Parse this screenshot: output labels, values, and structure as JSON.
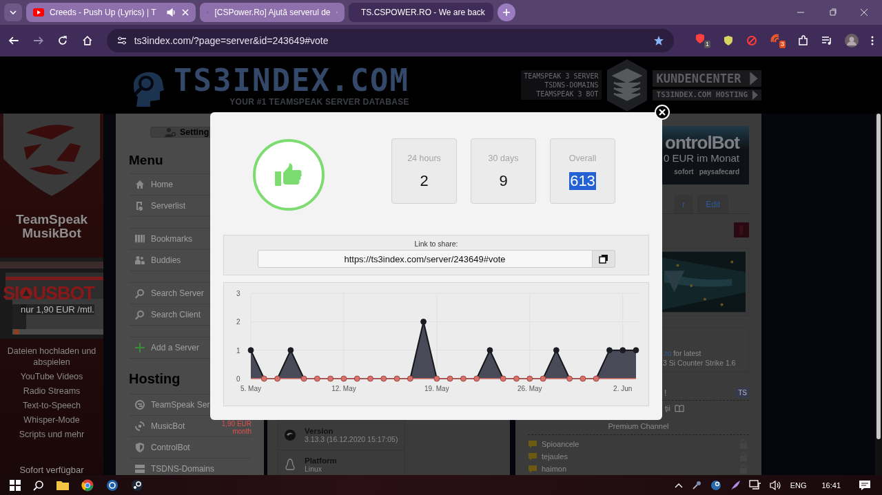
{
  "browser": {
    "tabs": [
      {
        "title": "Creeds - Push Up (Lyrics) | T",
        "selected": false,
        "playing_audio": true
      },
      {
        "title": "[CSPower.Ro] Ajută serverul de",
        "selected": false,
        "playing_audio": false
      },
      {
        "title": "TS.CSPOWER.RO - We are back",
        "selected": true,
        "playing_audio": false
      }
    ],
    "address": "ts3index.com/?page=server&id=243649#vote",
    "extension_badges": [
      "1",
      "3"
    ]
  },
  "site_header": {
    "logo": "TS3INDEX.COM",
    "tagline": "YOUR #1 TEAMSPEAK SERVER DATABASE",
    "services": [
      "TEAMSPEAK 3 SERVER",
      "TSDNS-DOMAINS",
      "TEAMSPEAK 3 BOT"
    ],
    "links": [
      "KUNDENCENTER",
      "TS3INDEX.COM HOSTING"
    ]
  },
  "left_ad": {
    "title": "TeamSpeak MusikBot",
    "brand_start": "SI",
    "brand_end": "USBOT",
    "price": "nur 1,90 EUR /mtl.",
    "features": [
      "Dateien hochladen und abspielen",
      "YouTube Videos",
      "Radio Streams",
      "Text-to-Speech",
      "Whisper-Mode",
      "Scripts und mehr"
    ],
    "footer": "Sofort verfügbar"
  },
  "sidebar": {
    "settings_button": "Setting",
    "menu_title": "Menu",
    "menu_groups": [
      [
        "Home",
        "Serverlist"
      ],
      [
        "Bookmarks",
        "Buddies"
      ],
      [
        "Search Server",
        "Search Client"
      ],
      [
        "Add a Server"
      ]
    ],
    "hosting_title": "Hosting",
    "hosting_items": [
      {
        "label": "TeamSpeak Ser"
      },
      {
        "label": "MusicBot",
        "price": "1,90 EUR",
        "period": "month"
      },
      {
        "label": "ControlBot"
      },
      {
        "label": "TSDNS-Domains"
      }
    ]
  },
  "server_info": [
    {
      "label": "Version",
      "value": "3.13.3 (16.12.2020 15:17:05)"
    },
    {
      "label": "Platform",
      "value": "Linux"
    }
  ],
  "right_panel": {
    "banner": {
      "headline": "ontrolBot",
      "price": "0 EUR  im Monat",
      "payments": [
        "sofort",
        "paysafecard"
      ]
    },
    "tabs": [
      {
        "label": "r",
        "selected": false
      },
      {
        "label": "Edit",
        "selected": false
      }
    ],
    "description": {
      "link": ".ro",
      "text": " for latest",
      "line2": "3 Si Counter Strike 1.6"
    },
    "viewer": {
      "title": "!",
      "badge": "TS",
      "top_channel": "ții",
      "premium": "Premium Channel",
      "channels": [
        {
          "name": "Spioancele",
          "locked": true
        },
        {
          "name": "tejaules",
          "locked": true
        },
        {
          "name": "haimon",
          "locked": true
        }
      ]
    }
  },
  "vote_modal": {
    "stats": [
      {
        "label": "24 hours",
        "value": "2",
        "highlighted": false
      },
      {
        "label": "30 days",
        "value": "9",
        "highlighted": false
      },
      {
        "label": "Overall",
        "value": "613",
        "highlighted": true
      }
    ],
    "share_label": "Link to share:",
    "share_url": "https://ts3index.com/server/243649#vote",
    "chart_data": {
      "type": "area",
      "categories": [
        "5. May",
        null,
        null,
        null,
        null,
        null,
        null,
        "12. May",
        null,
        null,
        null,
        null,
        null,
        null,
        "19. May",
        null,
        null,
        null,
        null,
        null,
        null,
        "26. May",
        null,
        null,
        null,
        null,
        null,
        null,
        "2. Jun",
        null
      ],
      "series": [
        {
          "color": "#484b57",
          "values": [
            1,
            0,
            0,
            1,
            0,
            0,
            0,
            0,
            0,
            0,
            0,
            0,
            0,
            2,
            0,
            0,
            0,
            0,
            1,
            0,
            0,
            0,
            0,
            1,
            0,
            0,
            0,
            1,
            1,
            1
          ]
        }
      ],
      "ylim": [
        0,
        3
      ],
      "yticks": [
        0,
        1,
        2,
        3
      ],
      "grid": true
    }
  },
  "taskbar": {
    "language": "ENG",
    "time": "16:41"
  }
}
